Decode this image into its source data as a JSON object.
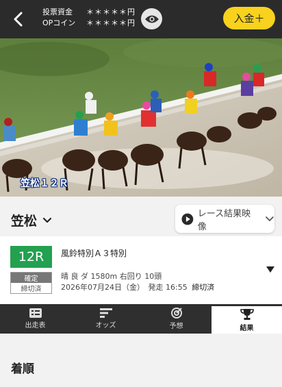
{
  "header": {
    "bet_funds_label": "投票資金",
    "bet_funds_value": "＊＊＊＊＊円",
    "op_coin_label": "OPコイン",
    "op_coin_value": "＊＊＊＊＊円",
    "deposit_label": "入金＋"
  },
  "video": {
    "overlay_text": "笠松１２Ｒ"
  },
  "venue": {
    "name": "笠松",
    "video_button_label": "レース結果映像"
  },
  "race": {
    "number": "12R",
    "status_confirmed": "確定",
    "status_closed": "締切済",
    "title": "風鈴特別Ａ３特別",
    "conditions": "晴 良 ダ 1580m 右回り 10頭",
    "date_line": "2026年07月24日（金）",
    "start_label": "発走 16:55",
    "closed_label": "締切済"
  },
  "tabs": [
    {
      "label": "出走表",
      "icon": "list-icon"
    },
    {
      "label": "オッズ",
      "icon": "odds-icon"
    },
    {
      "label": "予想",
      "icon": "target-icon"
    },
    {
      "label": "結果",
      "icon": "trophy-icon"
    }
  ],
  "results": {
    "heading": "着順"
  },
  "colors": {
    "accent_yellow": "#f8d21c",
    "race_green": "#23a050",
    "dark_bar": "#2b2b2b"
  }
}
